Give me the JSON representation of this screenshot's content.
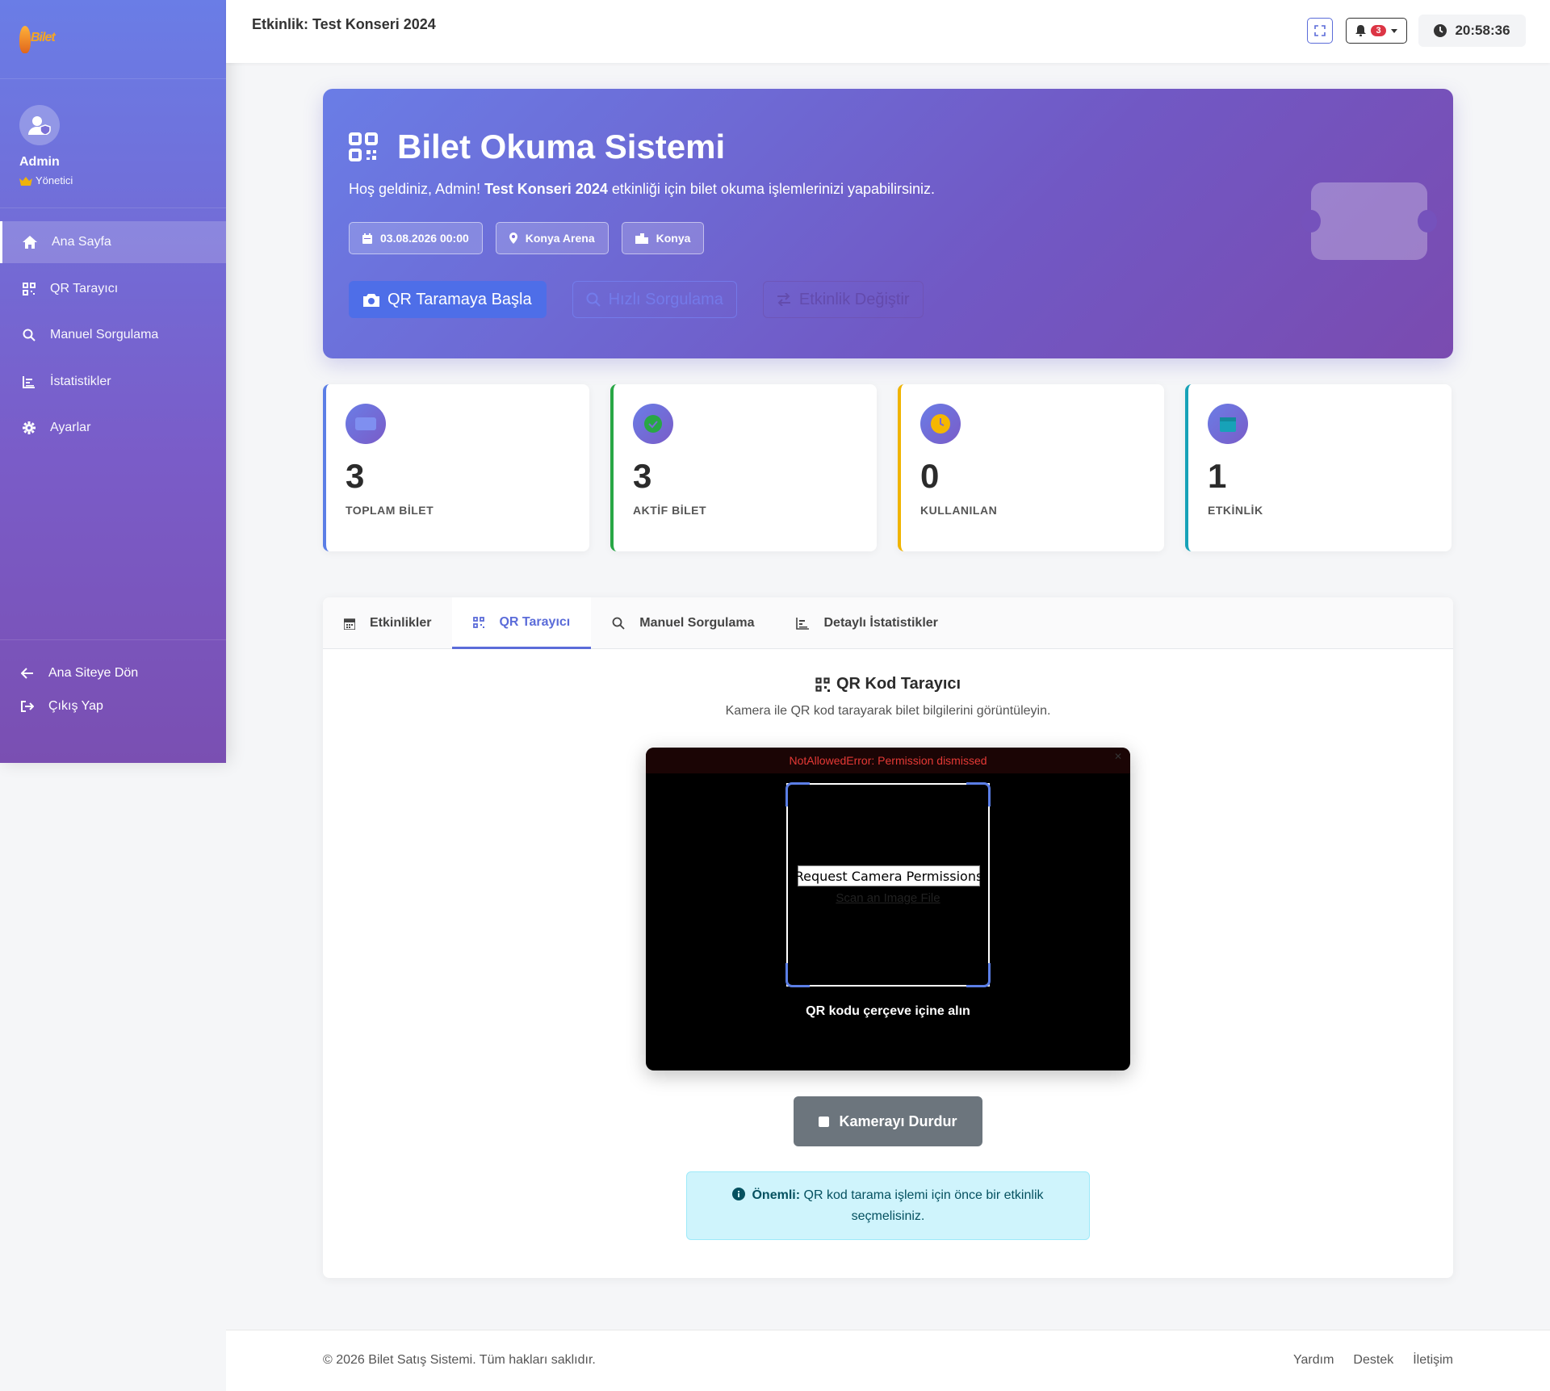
{
  "sidebar": {
    "logo_text": "Bilet",
    "user": {
      "name": "Admin",
      "role": "Yönetici"
    },
    "items": [
      {
        "label": "Ana Sayfa",
        "icon": "home-icon",
        "active": true
      },
      {
        "label": "QR Tarayıcı",
        "icon": "qr-icon"
      },
      {
        "label": "Manuel Sorgulama",
        "icon": "search-icon"
      },
      {
        "label": "İstatistikler",
        "icon": "chart-icon"
      },
      {
        "label": "Ayarlar",
        "icon": "gear-icon"
      }
    ],
    "bottom": [
      {
        "label": "Ana Siteye Dön",
        "icon": "arrow-left-icon"
      },
      {
        "label": "Çıkış Yap",
        "icon": "logout-icon"
      }
    ]
  },
  "topbar": {
    "title": "Etkinlik: Test Konseri 2024",
    "notification_count": "3",
    "clock": "20:58:36"
  },
  "hero": {
    "title": "Bilet Okuma Sistemi",
    "greeting_prefix": "Hoş geldiniz, Admin!",
    "event_name": "Test Konseri 2024",
    "greeting_suffix": "etkinliği için bilet okuma işlemlerinizi yapabilirsiniz.",
    "chips": {
      "date": "03.08.2026 00:00",
      "venue": "Konya Arena",
      "city": "Konya"
    },
    "buttons": {
      "scan": "QR Taramaya Başla",
      "quick": "Hızlı Sorgulama",
      "change": "Etkinlik Değiştir"
    }
  },
  "stats": [
    {
      "value": "3",
      "label": "TOPLAM BİLET",
      "color": "#5b7ee6"
    },
    {
      "value": "3",
      "label": "AKTİF BİLET",
      "color": "#28a745"
    },
    {
      "value": "0",
      "label": "KULLANILAN",
      "color": "#f0b400"
    },
    {
      "value": "1",
      "label": "ETKİNLİK",
      "color": "#17a2b8"
    }
  ],
  "tabs": [
    {
      "label": "Etkinlikler",
      "icon": "calendar-icon"
    },
    {
      "label": "QR Tarayıcı",
      "icon": "qr-icon",
      "active": true
    },
    {
      "label": "Manuel Sorgulama",
      "icon": "search-icon"
    },
    {
      "label": "Detaylı İstatistikler",
      "icon": "chart-icon"
    }
  ],
  "scanner": {
    "title": "QR Kod Tarayıcı",
    "subtitle": "Kamera ile QR kod tarayarak bilet bilgilerini görüntüleyin.",
    "error": "NotAllowedError: Permission dismissed",
    "permission_button": "Request Camera Permissions",
    "scan_file_link": "Scan an Image File",
    "hint": "QR kodu çerçeve içine alın",
    "stop_button": "Kamerayı Durdur",
    "alert_strong": "Önemli:",
    "alert_text": "QR kod tarama işlemi için önce bir etkinlik seçmelisiniz."
  },
  "footer": {
    "copyright": "© 2026 Bilet Satış Sistemi. Tüm hakları saklıdır.",
    "links": [
      "Yardım",
      "Destek",
      "İletişim"
    ]
  }
}
